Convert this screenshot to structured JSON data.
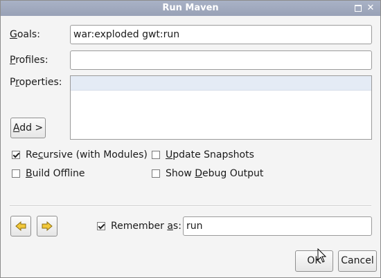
{
  "window": {
    "title": "Run Maven"
  },
  "fields": {
    "goals_label": "Goals:",
    "goals_value": "war:exploded gwt:run",
    "profiles_label": "Profiles:",
    "profiles_value": "",
    "properties_label": "Properties:",
    "add_button": "Add >"
  },
  "options": {
    "recursive": {
      "label": "Recursive (with Modules)",
      "checked": true
    },
    "update_snapshots": {
      "label": "Update Snapshots",
      "checked": false
    },
    "build_offline": {
      "label": "Build Offline",
      "checked": false
    },
    "show_debug": {
      "label": "Show Debug Output",
      "checked": false
    }
  },
  "remember": {
    "label": "Remember as:",
    "checked": true,
    "value": "run"
  },
  "buttons": {
    "ok": "OK",
    "cancel": "Cancel"
  },
  "icons": [
    "maximize-icon",
    "close-icon",
    "arrow-left-icon",
    "arrow-right-icon",
    "mouse-cursor-icon"
  ],
  "colors": {
    "titlebar": "#9ea7bc",
    "arrow_fill": "#f2c83a",
    "selected_row": "#e4ebf5"
  }
}
